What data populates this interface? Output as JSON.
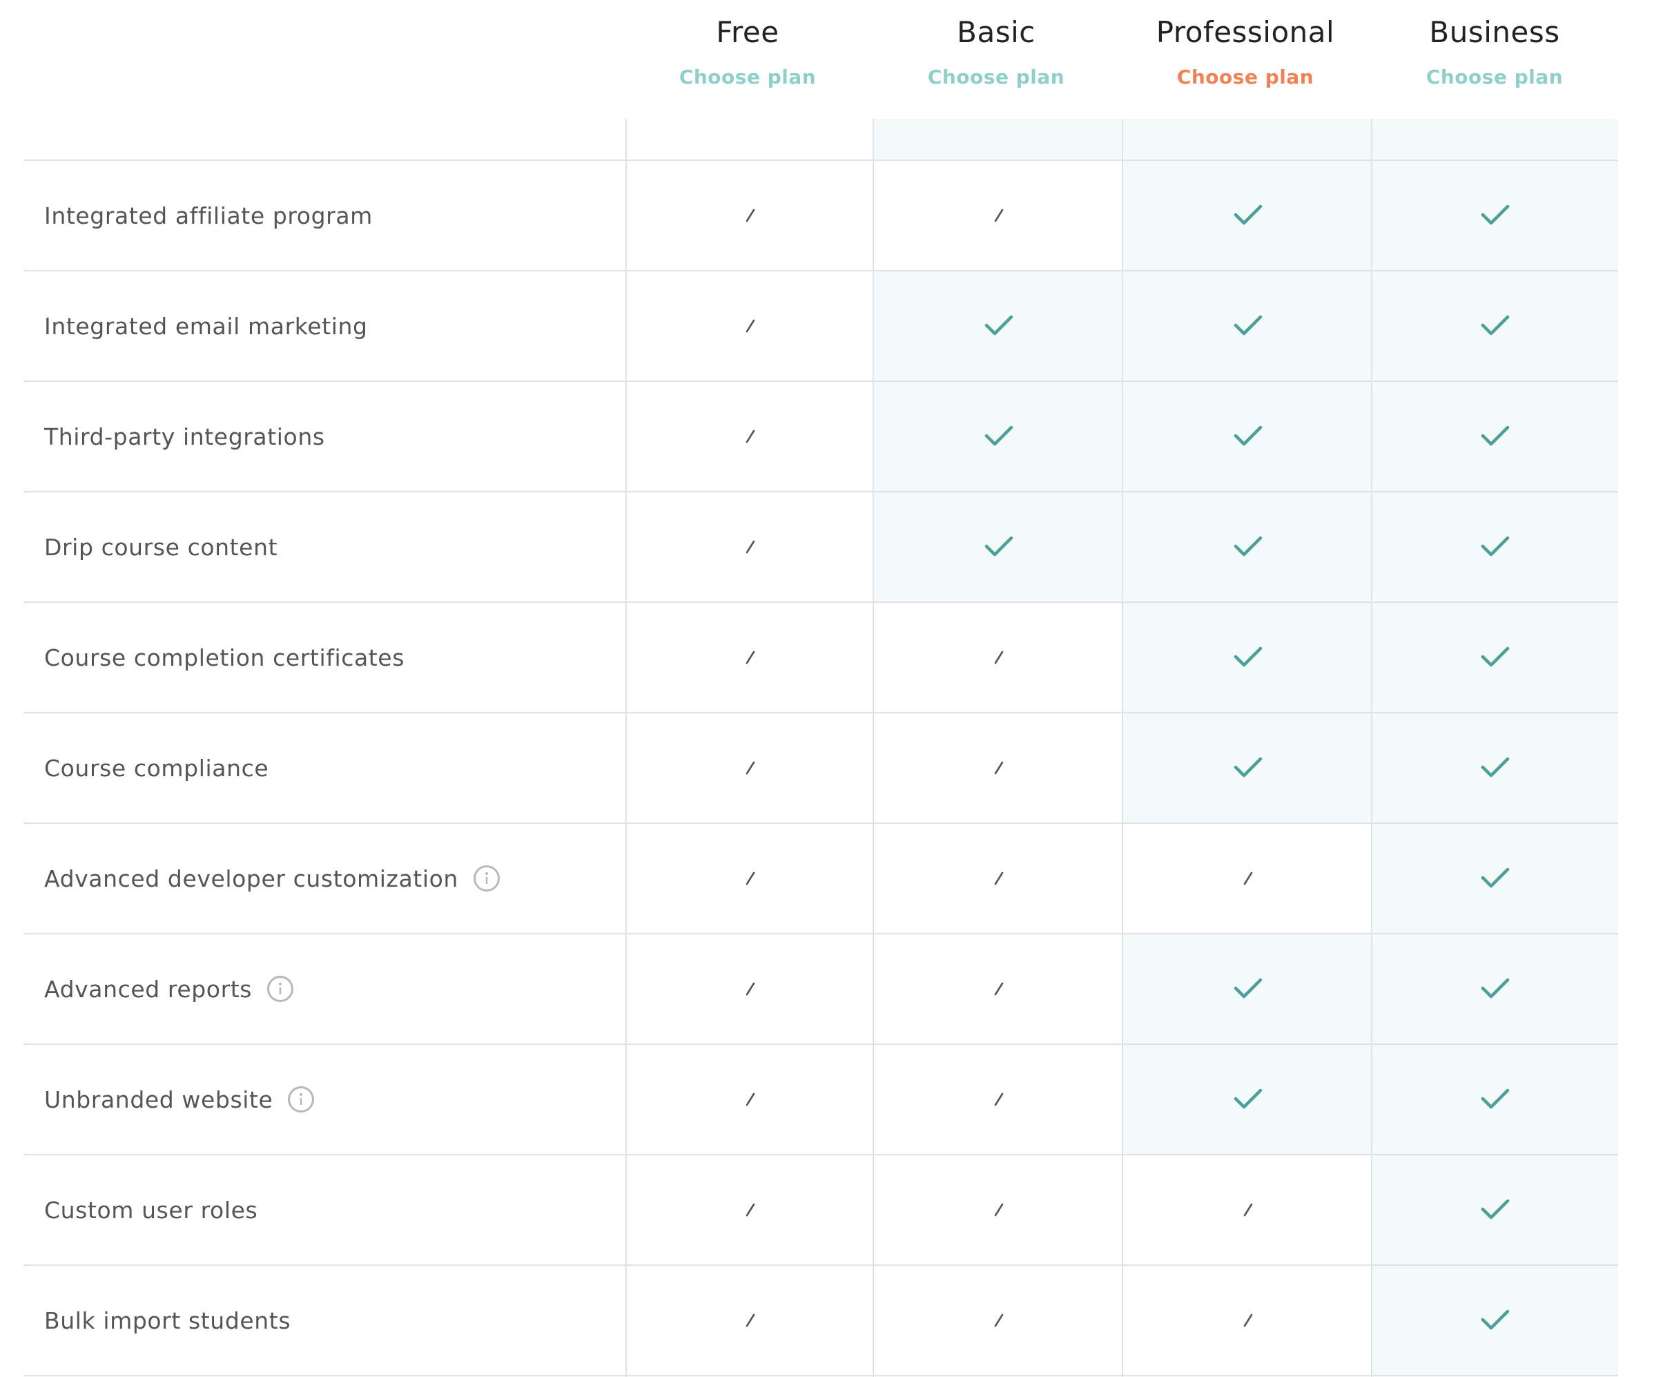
{
  "plans": [
    {
      "name": "Free",
      "cta": "Choose plan",
      "featured": false
    },
    {
      "name": "Basic",
      "cta": "Choose plan",
      "featured": false
    },
    {
      "name": "Professional",
      "cta": "Choose plan",
      "featured": true
    },
    {
      "name": "Business",
      "cta": "Choose plan",
      "featured": false
    }
  ],
  "colors": {
    "accent_link": "#8fcfca",
    "featured_link": "#ef8356",
    "check": "#4a9f98",
    "included_bg": "#f4f9f9",
    "divider": "#dfe3e4"
  },
  "icons": {
    "included": "check-icon",
    "excluded": "dash-icon",
    "info": "info-icon"
  },
  "features": [
    {
      "label": "Integrated affiliate program",
      "info": false,
      "included": [
        false,
        false,
        true,
        true
      ]
    },
    {
      "label": "Integrated email marketing",
      "info": false,
      "included": [
        false,
        true,
        true,
        true
      ]
    },
    {
      "label": "Third-party integrations",
      "info": false,
      "included": [
        false,
        true,
        true,
        true
      ]
    },
    {
      "label": "Drip course content",
      "info": false,
      "included": [
        false,
        true,
        true,
        true
      ]
    },
    {
      "label": "Course completion certificates",
      "info": false,
      "included": [
        false,
        false,
        true,
        true
      ]
    },
    {
      "label": "Course compliance",
      "info": false,
      "included": [
        false,
        false,
        true,
        true
      ]
    },
    {
      "label": "Advanced developer customization",
      "info": true,
      "included": [
        false,
        false,
        false,
        true
      ]
    },
    {
      "label": "Advanced reports",
      "info": true,
      "included": [
        false,
        false,
        true,
        true
      ]
    },
    {
      "label": "Unbranded website",
      "info": true,
      "included": [
        false,
        false,
        true,
        true
      ]
    },
    {
      "label": "Custom user roles",
      "info": false,
      "included": [
        false,
        false,
        false,
        true
      ]
    },
    {
      "label": "Bulk import students",
      "info": false,
      "included": [
        false,
        false,
        false,
        true
      ]
    }
  ]
}
